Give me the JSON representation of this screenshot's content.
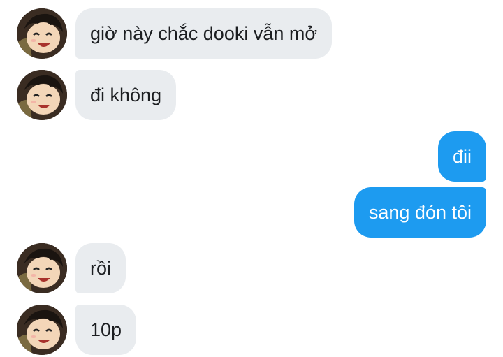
{
  "colors": {
    "incoming_bubble": "#e9ecef",
    "outgoing_bubble": "#1d9bf0",
    "incoming_text": "#1c1e21",
    "outgoing_text": "#ffffff"
  },
  "messages": [
    {
      "direction": "incoming",
      "text": "giờ này chắc dooki vẫn mở",
      "avatar_icon": "anime-boy-avatar-icon"
    },
    {
      "direction": "incoming",
      "text": "đi không",
      "avatar_icon": "anime-boy-avatar-icon"
    },
    {
      "direction": "outgoing",
      "text": "đii"
    },
    {
      "direction": "outgoing",
      "text": "sang đón tôi"
    },
    {
      "direction": "incoming",
      "text": "rồi",
      "avatar_icon": "anime-boy-avatar-icon"
    },
    {
      "direction": "incoming",
      "text": "10p",
      "avatar_icon": "anime-boy-avatar-icon"
    }
  ]
}
